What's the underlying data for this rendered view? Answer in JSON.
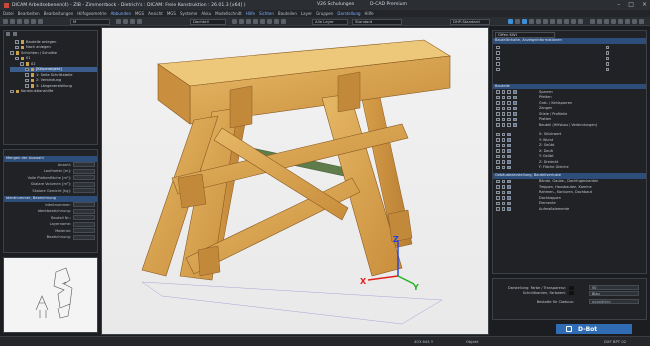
{
  "window": {
    "title": "DICAM Arbeitsebenen(4) - ZIB - Zimmerrbock - Dietrich's : DICAM: Freie Konstruktion : 26.01.3 [x64] )",
    "version": "V26  Schulungen",
    "product": "D-CAD Premium"
  },
  "menu": [
    "Datei",
    "Bearbeiten",
    "Bearbeitungen",
    "Hilfsgeometrie",
    "Abbunden",
    "MGS",
    "Ansicht",
    "MGS",
    "Systeme",
    "Akku",
    "Modellschnitt",
    "Hilfe",
    "Sichten",
    "Bauteilen",
    "Layer",
    "Gruppen",
    "Darstellung",
    "Hilfe"
  ],
  "menu_active": [
    4,
    11,
    12,
    16
  ],
  "toolbar": {
    "field1": "M",
    "field2": "Dachteil",
    "field3": "Alle Layer",
    "field4": "Standard",
    "field5": "DHP-Standard"
  },
  "left_tree": {
    "items": [
      {
        "label": "Bauteile anlegen",
        "indent": 1,
        "selected": false
      },
      {
        "label": "Nach anlegen",
        "indent": 1,
        "selected": false
      },
      {
        "label": "Schichten / Schnitte",
        "indent": 0,
        "selected": false
      },
      {
        "label": "01",
        "indent": 1,
        "selected": false
      },
      {
        "label": "02",
        "indent": 2,
        "selected": false
      },
      {
        "label": "[Körperobjekt]",
        "indent": 3,
        "selected": true
      },
      {
        "label": "1: Seite Schrittstelle",
        "indent": 3,
        "selected": false
      },
      {
        "label": "2: Verbindung",
        "indent": 3,
        "selected": false
      },
      {
        "label": "3: Längenerstellung",
        "indent": 3,
        "selected": false
      },
      {
        "label": "Konstruktionshilfe",
        "indent": 0,
        "selected": false
      }
    ]
  },
  "left_props": {
    "header": "Mengen der Auswahl",
    "rows": [
      "Anzahl:",
      "Laufmeter [m]:",
      "Volle Plattenfläche [m²]:",
      "Skalare Volumen [m³]:",
      "Skalare Gewicht [kg]:"
    ],
    "subheader": "Identnummer, Bezeichnung",
    "rows2": [
      "Identnummer:",
      "Identbezeichnung:",
      "Bauteil Nr.:",
      "Layername:",
      "Material:",
      "Bezeichnung:"
    ]
  },
  "right_panel": {
    "top_field": "Offen KWI",
    "sect1": "Bauteilinhalte, Anzeigeinformationen",
    "sect2": "Bauteile",
    "bauteile": [
      "Sparren",
      "Pfetten",
      "Grat- / Kehlsparren",
      "Zangen",
      "Stiele / Profileile",
      "Platten",
      "Bauteil (Hilfsbau / Verbindungen)"
    ],
    "sect3_items": [
      "X: Stückwert",
      "Y: Wurst",
      "Z: Geübt",
      "X: Dauß",
      "Y: Geübt",
      "Z: Dreieckt",
      "F: Fläche Gleiche"
    ],
    "sect4": "Gebäudedarstellung, Bauteilverluste",
    "sect4_items": [
      "Bände, Gaube-, Dachfugenkanten",
      "Treppen, Hausbauten, Kamine",
      "Rahmen-, Konturen, Dachbaut",
      "Dachkappen",
      "Elemente",
      "Aufmaßelemente"
    ],
    "bottom_rows": [
      "Darstellung: Farbe / Transparenz:",
      "Schnittkanten, Farbwert:",
      "Bestatte für Cladoux:"
    ],
    "bottom_vals": [
      "50",
      "Blau",
      "auswählen"
    ]
  },
  "status": {
    "left": "403.644 Y",
    "mid": "Objekt",
    "coords": "DXF BPT 02",
    "brand": "D-Bot"
  },
  "axes": {
    "x": "X",
    "y": "Y",
    "z": "Z"
  },
  "colors": {
    "wood": "#d9a24c",
    "accent": "#2d4d7a",
    "axis_x": "#e02020",
    "axis_y": "#20b020",
    "axis_z": "#2040e0"
  }
}
